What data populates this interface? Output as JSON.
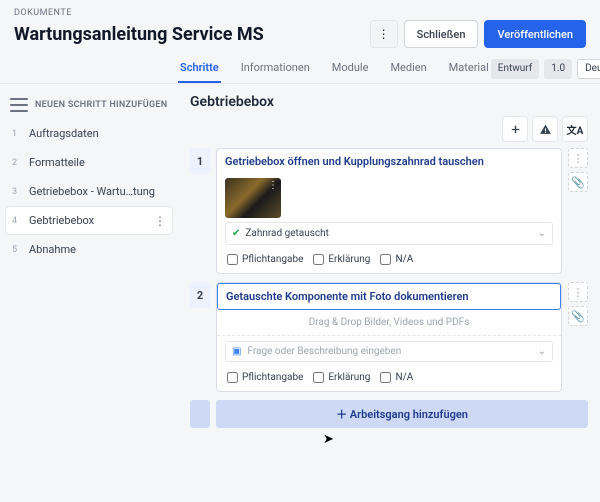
{
  "breadcrumb": "DOKUMENTE",
  "title": "Wartungsanleitung Service MS",
  "actions": {
    "close": "Schließen",
    "publish": "Veröffentlichen"
  },
  "tabs": [
    "Schritte",
    "Informationen",
    "Module",
    "Medien",
    "Material"
  ],
  "status": {
    "state": "Entwurf",
    "version": "1.0",
    "lang": "Deutsch"
  },
  "sidebar": {
    "add": "NEUEN SCHRITT HINZUFÜGEN",
    "items": [
      {
        "n": "1",
        "label": "Auftragsdaten"
      },
      {
        "n": "2",
        "label": "Formatteile"
      },
      {
        "n": "3",
        "label": "Getriebebox - Wartu…tung"
      },
      {
        "n": "4",
        "label": "Gebtriebebox"
      },
      {
        "n": "5",
        "label": "Abnahme"
      }
    ]
  },
  "main": {
    "heading": "Gebtriebebox",
    "steps": [
      {
        "n": "1",
        "title": "Getriebebox öffnen und Kupplungszahnrad tauschen",
        "sub": "Zahnrad getauscht",
        "opts": [
          "Pflichtangabe",
          "Erklärung",
          "N/A"
        ]
      },
      {
        "n": "2",
        "title": "Getauschte Komponente mit Foto dokumentieren",
        "drop": "Drag & Drop Bilder, Videos und PDFs",
        "prompt": "Frage oder Beschreibung eingeben",
        "opts": [
          "Pflichtangabe",
          "Erklärung",
          "N/A"
        ]
      }
    ],
    "addStep": "Arbeitsgang hinzufügen"
  }
}
